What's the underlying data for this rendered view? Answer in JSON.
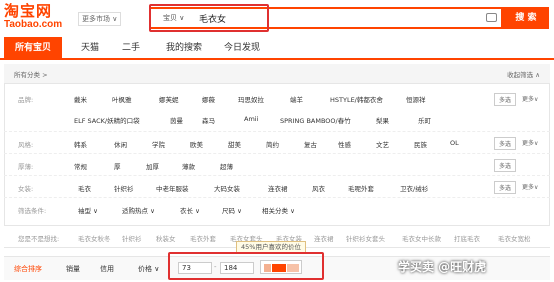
{
  "header": {
    "logo_cn": "淘宝网",
    "logo_en": "Taobao.com",
    "market": "更多市场 ∨"
  },
  "search": {
    "category": "宝贝 ∨",
    "keyword": "毛衣女",
    "button": "搜 索"
  },
  "tabs": [
    "所有宝贝",
    "天猫",
    "二手",
    "我的搜索",
    "今日发现"
  ],
  "breadcrumb": {
    "label": "所有分类 >",
    "collapse": "收起筛选 ∧"
  },
  "filters": {
    "brand": {
      "label": "品牌:",
      "row1": [
        "戴米",
        "叶枫雅",
        "娜芙妮",
        "娜薇",
        "玛思奴拉",
        "端羊",
        "HSTYLE/韩都衣舍",
        "恒源祥"
      ],
      "row2": [
        "ELF SACK/妖精的口袋",
        "茵曼",
        "森马",
        "Amii",
        "SPRING BAMBOO/春竹",
        "梨果",
        "乐町"
      ]
    },
    "style": {
      "label": "风格:",
      "items": [
        "韩系",
        "休闲",
        "学院",
        "欧美",
        "甜美",
        "简约",
        "复古",
        "性感",
        "文艺",
        "民族",
        "OL"
      ]
    },
    "thickness": {
      "label": "厚薄:",
      "items": [
        "常规",
        "厚",
        "加厚",
        "薄款",
        "超薄"
      ]
    },
    "womens_wear": {
      "label": "女装:",
      "items": [
        "毛衣",
        "针织衫",
        "中老年服装",
        "大码女装",
        "连衣裙",
        "风衣",
        "毛呢外套",
        "卫衣/绒衫"
      ]
    },
    "more": {
      "label": "筛选条件:",
      "items": [
        "袖型 ∨",
        "适购热点 ∨",
        "衣长 ∨",
        "尺码 ∨",
        "相关分类 ∨"
      ]
    }
  },
  "controls": {
    "multi": "多选",
    "more": "更多∨"
  },
  "looking": {
    "label": "您是不是想找:",
    "items": [
      "毛衣女秋冬",
      "针织衫",
      "秋装女",
      "毛衣外套",
      "毛衣女套头",
      "毛衣女装",
      "连衣裙",
      "针织衫女套头",
      "毛衣女中长款",
      "打底毛衣",
      "毛衣女宽松"
    ]
  },
  "tooltip": "45%用户喜欢的价位",
  "sort": {
    "items": [
      "综合排序",
      "销量",
      "信用",
      "价格 ∨"
    ],
    "price_min": "73",
    "price_max": "184",
    "dash": "-"
  },
  "watermark": "学买卖 @旺财虎",
  "colors": {
    "accent": "#ff4400",
    "highlight": "#e03030"
  }
}
